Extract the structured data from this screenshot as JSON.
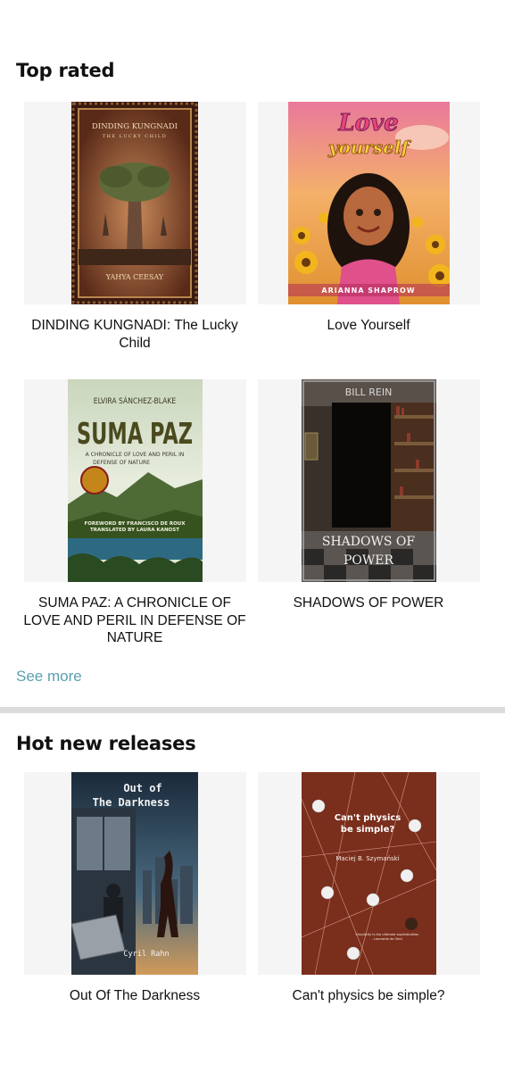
{
  "top_rated": {
    "title": "Top rated",
    "see_more": "See more",
    "books": [
      {
        "title": "DINDING KUNGNADI: The Lucky Child",
        "cover": {
          "heading": "DINDING KUNGNADI",
          "subheading": "THE LUCKY CHILD",
          "author": "YAHYA CEESAY"
        }
      },
      {
        "title": "Love Yourself",
        "cover": {
          "heading_1": "Love",
          "heading_2": "yourself",
          "author": "ARIANNA SHAPROW"
        }
      },
      {
        "title": "SUMA PAZ: A CHRONICLE OF LOVE AND PERIL IN DEFENSE OF NATURE",
        "cover": {
          "author": "ELVIRA SÁNCHEZ-BLAKE",
          "heading": "SUMA PAZ",
          "subheading_1": "A CHRONICLE OF LOVE AND PERIL IN",
          "subheading_2": "DEFENSE OF NATURE",
          "credit_1": "FOREWORD BY FRANCISCO DE ROUX",
          "credit_2": "TRANSLATED BY LAURA KANOST"
        }
      },
      {
        "title": "SHADOWS OF POWER",
        "cover": {
          "author": "BILL REIN",
          "heading_1": "SHADOWS OF",
          "heading_2": "POWER"
        }
      }
    ]
  },
  "hot_new": {
    "title": "Hot new releases",
    "books": [
      {
        "title": "Out Of The Darkness",
        "cover": {
          "heading_1": "Out of",
          "heading_2": "The Darkness",
          "author": "Cyril Rahn"
        }
      },
      {
        "title": "Can't physics be simple?",
        "cover": {
          "heading_1": "Can't physics",
          "heading_2": "be simple?",
          "author": "Maciej B. Szymański",
          "tagline_1": "Simplicity is the ultimate sophistication",
          "tagline_2": "- Leonardo da Vinci"
        }
      }
    ]
  }
}
